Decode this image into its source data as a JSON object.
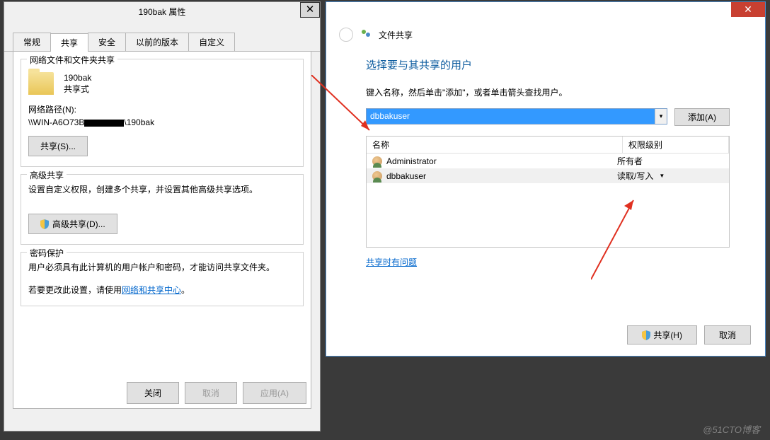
{
  "props": {
    "title": "190bak 属性",
    "tabs": [
      "常规",
      "共享",
      "安全",
      "以前的版本",
      "自定义"
    ],
    "activeTab": 1,
    "netShare": {
      "groupTitle": "网络文件和文件夹共享",
      "folderName": "190bak",
      "shareStatus": "共享式",
      "pathLabel": "网络路径(N):",
      "pathPrefix": "\\\\WIN-A6O73B",
      "pathSuffix": "\\190bak",
      "shareBtn": "共享(S)..."
    },
    "advShare": {
      "groupTitle": "高级共享",
      "description": "设置自定义权限，创建多个共享，并设置其他高级共享选项。",
      "btn": "高级共享(D)..."
    },
    "pwdProtect": {
      "groupTitle": "密码保护",
      "line1": "用户必须具有此计算机的用户帐户和密码，才能访问共享文件夹。",
      "line2a": "若要更改此设置，请使用",
      "link": "网络和共享中心",
      "line2b": "。"
    },
    "footerBtns": {
      "close": "关闭",
      "cancel": "取消",
      "apply": "应用(A)"
    }
  },
  "share": {
    "headerTitle": "文件共享",
    "h1": "选择要与其共享的用户",
    "instruction": "键入名称，然后单击\"添加\"，或者单击箭头查找用户。",
    "comboValue": "dbbakuser",
    "addBtn": "添加(A)",
    "columns": {
      "name": "名称",
      "perm": "权限级别"
    },
    "rows": [
      {
        "name": "Administrator",
        "perm": "所有者",
        "dropdown": false
      },
      {
        "name": "dbbakuser",
        "perm": "读取/写入",
        "dropdown": true
      }
    ],
    "problemLink": "共享时有问题",
    "footerBtns": {
      "share": "共享(H)",
      "cancel": "取消"
    }
  },
  "watermark": "@51CTO博客"
}
